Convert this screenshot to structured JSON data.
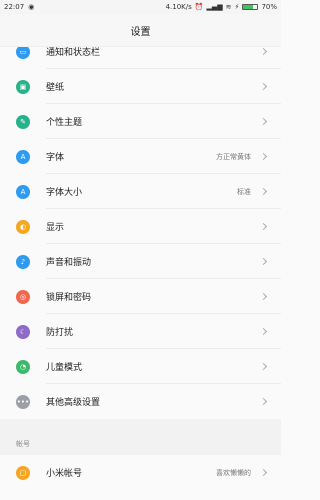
{
  "status_bar": {
    "time": "22:07",
    "speed": "4.10K/s",
    "battery_percent": "70%",
    "battery_level": 0.7
  },
  "header": {
    "title": "设置"
  },
  "items": [
    {
      "label": "通知和状态栏",
      "icon": "notification-icon",
      "color": "#2e9bf0",
      "value": ""
    },
    {
      "label": "壁纸",
      "icon": "wallpaper-icon",
      "color": "#26b28a",
      "value": ""
    },
    {
      "label": "个性主题",
      "icon": "theme-icon",
      "color": "#26b28a",
      "value": ""
    },
    {
      "label": "字体",
      "icon": "font-icon",
      "color": "#2e9bf0",
      "value": "方正常黄体"
    },
    {
      "label": "字体大小",
      "icon": "font-size-icon",
      "color": "#2e9bf0",
      "value": "标准"
    },
    {
      "label": "显示",
      "icon": "display-icon",
      "color": "#f5a623",
      "value": ""
    },
    {
      "label": "声音和振动",
      "icon": "sound-icon",
      "color": "#2e9bf0",
      "value": ""
    },
    {
      "label": "锁屏和密码",
      "icon": "lock-icon",
      "color": "#f0674f",
      "value": ""
    },
    {
      "label": "防打扰",
      "icon": "moon-icon",
      "color": "#8e6bc7",
      "value": ""
    },
    {
      "label": "儿童模式",
      "icon": "child-mode-icon",
      "color": "#3cb96b",
      "value": ""
    },
    {
      "label": "其他高级设置",
      "icon": "more-icon",
      "color": "#9aa0a6",
      "value": ""
    }
  ],
  "section_account": {
    "title": "帐号"
  },
  "account": {
    "label": "小米帐号",
    "icon": "mi-account-icon",
    "color": "#f5a623",
    "value": "喜欢懒懒的"
  }
}
